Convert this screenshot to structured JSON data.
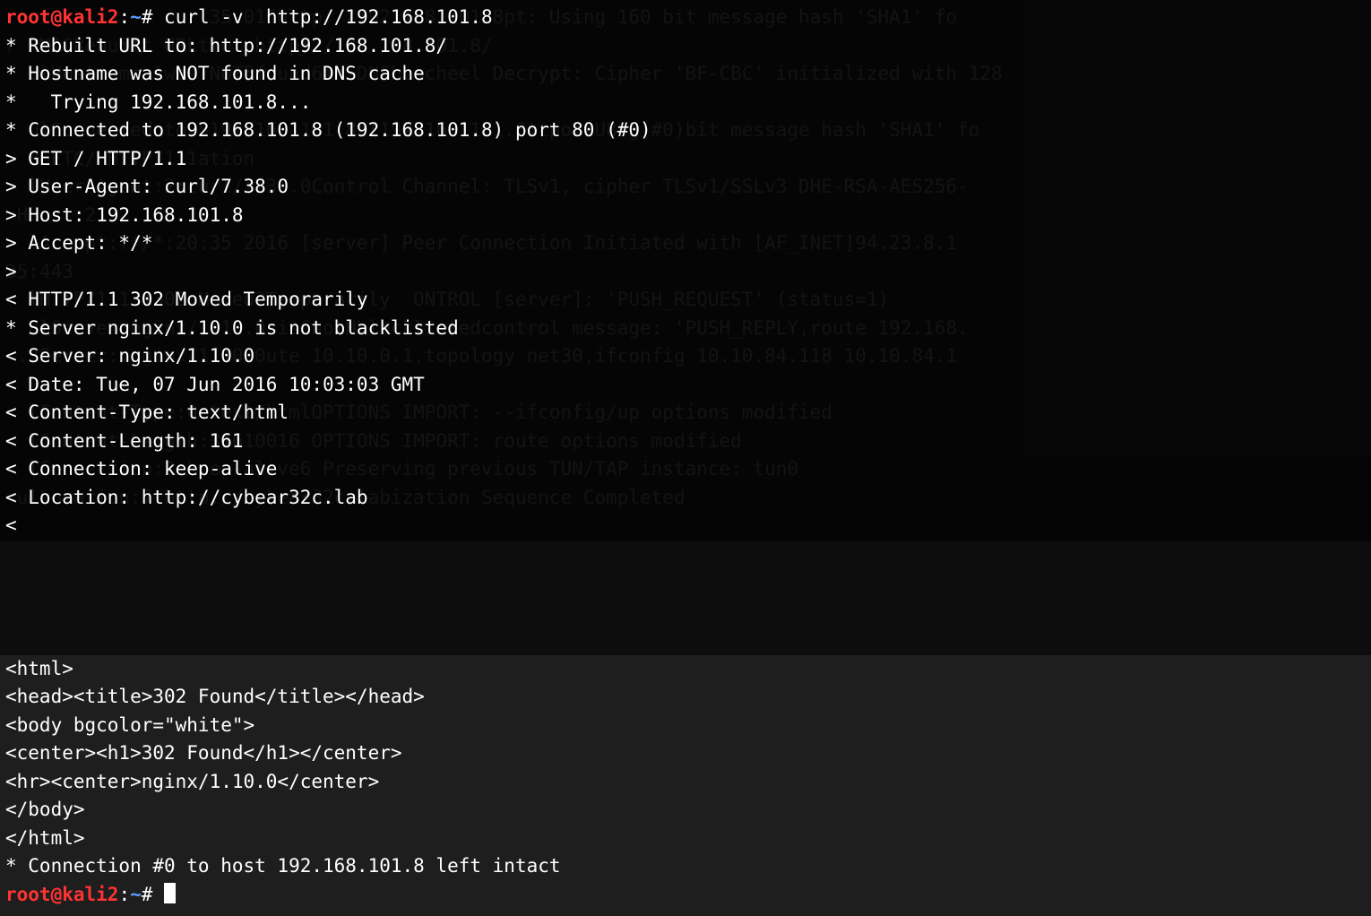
{
  "bg_lines": [
    "root@kali2:~# curl35v016http://192.168.101.8pt: Using 160 bit message hash 'SHA1' fo",
    "r HMACRebuilt URLtto:ohttp://192.168.101.8/",
    "* ulHostname 1was:NOT5found6in DNShcacheel Decrypt: Cipher 'BF-CBC' initialized with 128",
    "*   Trying 192.168.101.8...",
    "* ulConnected to25192.168.101.8a(192.168.101.8)tportU80g(#0)bit message hash 'SHA1' fo",
    "> HGETC/ HTTP/1.1ation",
    "> lUser-Agent:2:curl/7.38.0Control Channel: TLSv1, cipher TLSv1/SSLv3 DHE-RSA-AES256-",
    ">HHost:2192.168.101.8",
    "> lAccept:7*/*:20:35 2016 [server] Peer Connection Initiated with [AF_INET]94.23.8.1",
    "35:443",
    "< lHTTP/1.1 1302:Moved2Temporarily  ONTROL [server]: 'PUSH_REQUEST' (status=1)",
    "* ulServer nginx/1.10.0 is6notHblacklistedcontrol message: 'PUSH_REPLY,route 192.168.",
    "<.3Server:.nginx/1.10.0ute 10.10.0.1,topology net30,ifconfig 10.10.84.118 10.10.84.1",
    "< Date: Tue, 07 Jun 2016 10:03:03 GMT",
    "< lContent-Type:0:text/htmlOPTIONS IMPORT: --ifconfig/up options modified",
    "< lContent-Length:31610016 OPTIONS IMPORT: route options modified",
    "< lConnection:2:keep-alive6 Preserving previous TUN/TAP instance: tun0",
    "<ulLocation:7 http://cybear32c.labization Sequence Completed",
    "<"
  ],
  "prompt1": {
    "user": "root@kali2",
    "sep": ":",
    "cwd": "~",
    "hash": "#"
  },
  "cmd1": " curl -v  http://192.168.101.8",
  "fg_lines": [
    "* Rebuilt URL to: http://192.168.101.8/",
    "* Hostname was NOT found in DNS cache",
    "*   Trying 192.168.101.8...",
    "* Connected to 192.168.101.8 (192.168.101.8) port 80 (#0)",
    "> GET / HTTP/1.1",
    "> User-Agent: curl/7.38.0",
    "> Host: 192.168.101.8",
    "> Accept: */*",
    ">",
    "< HTTP/1.1 302 Moved Temporarily",
    "* Server nginx/1.10.0 is not blacklisted",
    "< Server: nginx/1.10.0",
    "< Date: Tue, 07 Jun 2016 10:03:03 GMT",
    "< Content-Type: text/html",
    "< Content-Length: 161",
    "< Connection: keep-alive",
    "< Location: http://cybear32c.lab",
    "<"
  ],
  "bottom_lines": [
    "<html>",
    "<head><title>302 Found</title></head>",
    "<body bgcolor=\"white\">",
    "<center><h1>302 Found</h1></center>",
    "<hr><center>nginx/1.10.0</center>",
    "</body>",
    "</html>",
    "* Connection #0 to host 192.168.101.8 left intact"
  ],
  "prompt2": {
    "user": "root@kali2",
    "sep": ":",
    "cwd": "~",
    "hash": "#"
  }
}
